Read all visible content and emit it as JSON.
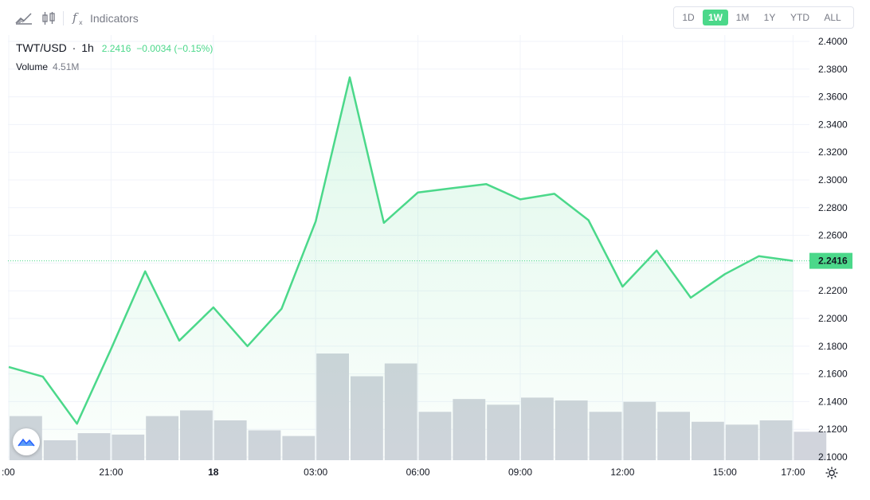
{
  "toolbar": {
    "indicators_label": "Indicators",
    "ranges": [
      "1D",
      "1W",
      "1M",
      "1Y",
      "YTD",
      "ALL"
    ],
    "active_range": "1W",
    "icons": [
      "line-chart-icon",
      "candles-icon",
      "fx-icon"
    ]
  },
  "legend": {
    "symbol": "TWT/USD",
    "interval": "1h",
    "last": "2.2416",
    "change": "−0.0034 (−0.15%)",
    "volume_label": "Volume",
    "volume_value": "4.51M"
  },
  "colors": {
    "line": "#4bd88a",
    "volume": "#d1d4dc",
    "grid": "#f0f3fa",
    "text": "#131722",
    "muted": "#787b86"
  },
  "chart_data": {
    "type": "area",
    "ylim": [
      2.1,
      2.4
    ],
    "yticks": [
      "2.1000",
      "2.1200",
      "2.1400",
      "2.1600",
      "2.1800",
      "2.2000",
      "2.2200",
      "2.2400",
      "2.2600",
      "2.2800",
      "2.3000",
      "2.3200",
      "2.3400",
      "2.3600",
      "2.3800",
      "2.4000"
    ],
    "xticks": [
      {
        "i": 0,
        "label": ":00"
      },
      {
        "i": 3,
        "label": "21:00"
      },
      {
        "i": 6,
        "label": "18",
        "bold": true
      },
      {
        "i": 9,
        "label": "03:00"
      },
      {
        "i": 12,
        "label": "06:00"
      },
      {
        "i": 15,
        "label": "09:00"
      },
      {
        "i": 18,
        "label": "12:00"
      },
      {
        "i": 21,
        "label": "15:00"
      },
      {
        "i": 23,
        "label": "17:00"
      }
    ],
    "series": [
      {
        "values": [
          2.165,
          2.158,
          2.124,
          2.178,
          2.234,
          2.184,
          2.208,
          2.18,
          2.207,
          2.27,
          2.374,
          2.269,
          2.291,
          2.294,
          2.297,
          2.286,
          2.29,
          2.271,
          2.223,
          2.249,
          2.215,
          2.232,
          2.245,
          2.2416
        ]
      }
    ],
    "volume": [
      1.31,
      1.14,
      1.19,
      1.18,
      1.31,
      1.35,
      1.28,
      1.21,
      1.17,
      1.75,
      1.59,
      1.68,
      1.34,
      1.43,
      1.39,
      1.44,
      1.42,
      1.34,
      1.41,
      1.34,
      1.27,
      1.25,
      1.28,
      1.2
    ],
    "last_price_label": "2.2416",
    "grid": true
  }
}
